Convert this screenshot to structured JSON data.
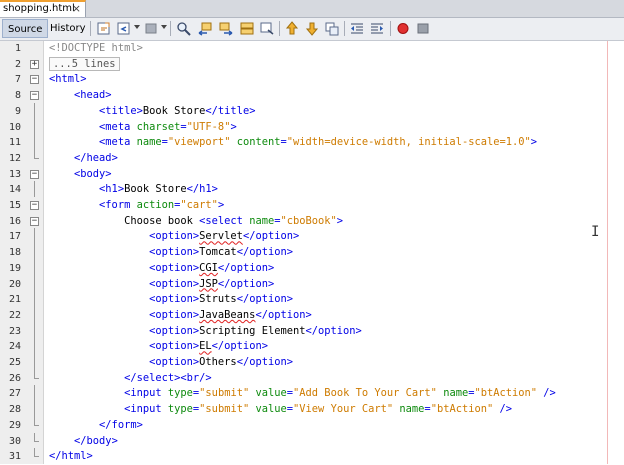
{
  "file_tab": {
    "name": "shopping.html",
    "close": "×"
  },
  "toolbar": {
    "source_tab": "Source",
    "history_tab": "History",
    "icons": [
      "last-edit-icon",
      "back-icon",
      "forward-icon",
      "find-icon",
      "find-previous-icon",
      "find-next-icon",
      "find-selection-icon",
      "toggle-highlight-icon",
      "prev-bookmark-icon",
      "next-bookmark-icon",
      "toggle-bookmark-icon",
      "shift-left-icon",
      "shift-right-icon",
      "start-macro-icon",
      "stop-macro-icon"
    ]
  },
  "lines": [
    {
      "num": "1",
      "fold": "none",
      "code": [
        [
          "gray",
          "<!DOCTYPE html>"
        ]
      ]
    },
    {
      "num": "2",
      "fold": "plus",
      "code": [
        [
          "collapsed",
          "...5 lines"
        ]
      ]
    },
    {
      "num": "7",
      "fold": "minus",
      "code": [
        [
          "tag",
          "<html>"
        ]
      ]
    },
    {
      "num": "8",
      "fold": "minus",
      "code": [
        [
          "txt",
          "    "
        ],
        [
          "tag",
          "<head>"
        ]
      ]
    },
    {
      "num": "9",
      "fold": "guide",
      "code": [
        [
          "txt",
          "        "
        ],
        [
          "tag",
          "<title>"
        ],
        [
          "txt",
          "Book Store"
        ],
        [
          "tag",
          "</title>"
        ]
      ]
    },
    {
      "num": "10",
      "fold": "guide",
      "code": [
        [
          "txt",
          "        "
        ],
        [
          "tag",
          "<meta "
        ],
        [
          "attr",
          "charset"
        ],
        [
          "tag",
          "="
        ],
        [
          "val",
          "\"UTF-8\""
        ],
        [
          "tag",
          ">"
        ]
      ]
    },
    {
      "num": "11",
      "fold": "guide",
      "code": [
        [
          "txt",
          "        "
        ],
        [
          "tag",
          "<meta "
        ],
        [
          "attr",
          "name"
        ],
        [
          "tag",
          "="
        ],
        [
          "val",
          "\"viewport\""
        ],
        [
          "tag",
          " "
        ],
        [
          "attr",
          "content"
        ],
        [
          "tag",
          "="
        ],
        [
          "val",
          "\"width=device-width, initial-scale=1.0\""
        ],
        [
          "tag",
          ">"
        ]
      ]
    },
    {
      "num": "12",
      "fold": "end",
      "code": [
        [
          "txt",
          "    "
        ],
        [
          "tag",
          "</head>"
        ]
      ]
    },
    {
      "num": "13",
      "fold": "minus",
      "code": [
        [
          "txt",
          "    "
        ],
        [
          "tag",
          "<body>"
        ]
      ]
    },
    {
      "num": "14",
      "fold": "guide",
      "code": [
        [
          "txt",
          "        "
        ],
        [
          "tag",
          "<h1>"
        ],
        [
          "txt",
          "Book Store"
        ],
        [
          "tag",
          "</h1>"
        ]
      ]
    },
    {
      "num": "15",
      "fold": "minus",
      "code": [
        [
          "txt",
          "        "
        ],
        [
          "tag",
          "<form "
        ],
        [
          "attr",
          "action"
        ],
        [
          "tag",
          "="
        ],
        [
          "val",
          "\"cart\""
        ],
        [
          "tag",
          ">"
        ]
      ]
    },
    {
      "num": "16",
      "fold": "minus",
      "code": [
        [
          "txt",
          "            Choose book "
        ],
        [
          "tag",
          "<select "
        ],
        [
          "attr",
          "name"
        ],
        [
          "tag",
          "="
        ],
        [
          "val",
          "\"cboBook\""
        ],
        [
          "tag",
          ">"
        ]
      ]
    },
    {
      "num": "17",
      "fold": "guide",
      "code": [
        [
          "txt",
          "                "
        ],
        [
          "tag",
          "<option>"
        ],
        [
          "squig",
          "Servlet"
        ],
        [
          "tag",
          "</option>"
        ]
      ]
    },
    {
      "num": "18",
      "fold": "guide",
      "code": [
        [
          "txt",
          "                "
        ],
        [
          "tag",
          "<option>"
        ],
        [
          "txt",
          "Tomcat"
        ],
        [
          "tag",
          "</option>"
        ]
      ]
    },
    {
      "num": "19",
      "fold": "guide",
      "code": [
        [
          "txt",
          "                "
        ],
        [
          "tag",
          "<option>"
        ],
        [
          "squig",
          "CGI"
        ],
        [
          "tag",
          "</option>"
        ]
      ]
    },
    {
      "num": "20",
      "fold": "guide",
      "code": [
        [
          "txt",
          "                "
        ],
        [
          "tag",
          "<option>"
        ],
        [
          "squig",
          "JSP"
        ],
        [
          "tag",
          "</option>"
        ]
      ]
    },
    {
      "num": "21",
      "fold": "guide",
      "code": [
        [
          "txt",
          "                "
        ],
        [
          "tag",
          "<option>"
        ],
        [
          "txt",
          "Struts"
        ],
        [
          "tag",
          "</option>"
        ]
      ]
    },
    {
      "num": "22",
      "fold": "guide",
      "code": [
        [
          "txt",
          "                "
        ],
        [
          "tag",
          "<option>"
        ],
        [
          "squig",
          "JavaBeans"
        ],
        [
          "tag",
          "</option>"
        ]
      ]
    },
    {
      "num": "23",
      "fold": "guide",
      "code": [
        [
          "txt",
          "                "
        ],
        [
          "tag",
          "<option>"
        ],
        [
          "txt",
          "Scripting Element"
        ],
        [
          "tag",
          "</option>"
        ]
      ]
    },
    {
      "num": "24",
      "fold": "guide",
      "code": [
        [
          "txt",
          "                "
        ],
        [
          "tag",
          "<option>"
        ],
        [
          "squig",
          "EL"
        ],
        [
          "tag",
          "</option>"
        ]
      ]
    },
    {
      "num": "25",
      "fold": "guide",
      "code": [
        [
          "txt",
          "                "
        ],
        [
          "tag",
          "<option>"
        ],
        [
          "txt",
          "Others"
        ],
        [
          "tag",
          "</option>"
        ]
      ]
    },
    {
      "num": "26",
      "fold": "end",
      "code": [
        [
          "txt",
          "            "
        ],
        [
          "tag",
          "</select><br/>"
        ]
      ]
    },
    {
      "num": "27",
      "fold": "guide",
      "code": [
        [
          "txt",
          "            "
        ],
        [
          "tag",
          "<input "
        ],
        [
          "attr",
          "type"
        ],
        [
          "tag",
          "="
        ],
        [
          "val",
          "\"submit\""
        ],
        [
          "tag",
          " "
        ],
        [
          "attr",
          "value"
        ],
        [
          "tag",
          "="
        ],
        [
          "val",
          "\"Add Book To Your Cart\""
        ],
        [
          "tag",
          " "
        ],
        [
          "attr",
          "name"
        ],
        [
          "tag",
          "="
        ],
        [
          "val",
          "\"btAction\""
        ],
        [
          "tag",
          " />"
        ]
      ]
    },
    {
      "num": "28",
      "fold": "guide",
      "code": [
        [
          "txt",
          "            "
        ],
        [
          "tag",
          "<input "
        ],
        [
          "attr",
          "type"
        ],
        [
          "tag",
          "="
        ],
        [
          "val",
          "\"submit\""
        ],
        [
          "tag",
          " "
        ],
        [
          "attr",
          "value"
        ],
        [
          "tag",
          "="
        ],
        [
          "val",
          "\"View Your Cart\""
        ],
        [
          "tag",
          " "
        ],
        [
          "attr",
          "name"
        ],
        [
          "tag",
          "="
        ],
        [
          "val",
          "\"btAction\""
        ],
        [
          "tag",
          " />"
        ]
      ]
    },
    {
      "num": "29",
      "fold": "end",
      "code": [
        [
          "txt",
          "        "
        ],
        [
          "tag",
          "</form>"
        ]
      ]
    },
    {
      "num": "30",
      "fold": "end",
      "code": [
        [
          "txt",
          "    "
        ],
        [
          "tag",
          "</body>"
        ]
      ]
    },
    {
      "num": "31",
      "fold": "end",
      "code": [
        [
          "tag",
          "</html>"
        ]
      ]
    }
  ]
}
